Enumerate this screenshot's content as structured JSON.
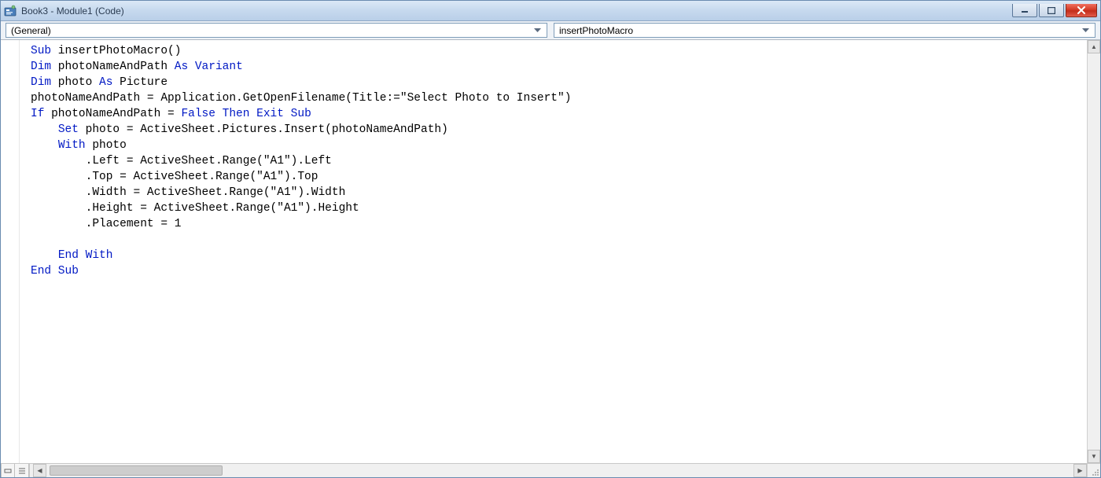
{
  "window": {
    "title": "Book3 - Module1 (Code)"
  },
  "dropdowns": {
    "object": "(General)",
    "procedure": "insertPhotoMacro"
  },
  "icons": {
    "app": "vba-module-icon",
    "minimize": "minimize-icon",
    "maximize": "maximize-icon",
    "close": "close-icon",
    "chevron": "chevron-down-icon",
    "scrollUp": "scroll-up-icon",
    "scrollDown": "scroll-down-icon",
    "procView": "procedure-view-icon",
    "fullView": "full-module-view-icon",
    "grip": "resize-grip-icon"
  },
  "code": {
    "tokens": [
      [
        {
          "t": "kw",
          "v": "Sub"
        },
        {
          "t": "",
          "v": " insertPhotoMacro()"
        }
      ],
      [
        {
          "t": "kw",
          "v": "Dim"
        },
        {
          "t": "",
          "v": " photoNameAndPath "
        },
        {
          "t": "kw",
          "v": "As Variant"
        }
      ],
      [
        {
          "t": "kw",
          "v": "Dim"
        },
        {
          "t": "",
          "v": " photo "
        },
        {
          "t": "kw",
          "v": "As"
        },
        {
          "t": "",
          "v": " Picture"
        }
      ],
      [
        {
          "t": "",
          "v": "photoNameAndPath = Application.GetOpenFilename(Title:=\"Select Photo to Insert\")"
        }
      ],
      [
        {
          "t": "kw",
          "v": "If"
        },
        {
          "t": "",
          "v": " photoNameAndPath = "
        },
        {
          "t": "kw",
          "v": "False Then Exit Sub"
        }
      ],
      [
        {
          "t": "",
          "v": "    "
        },
        {
          "t": "kw",
          "v": "Set"
        },
        {
          "t": "",
          "v": " photo = ActiveSheet.Pictures.Insert(photoNameAndPath)"
        }
      ],
      [
        {
          "t": "",
          "v": "    "
        },
        {
          "t": "kw",
          "v": "With"
        },
        {
          "t": "",
          "v": " photo"
        }
      ],
      [
        {
          "t": "",
          "v": "        .Left = ActiveSheet.Range(\"A1\").Left"
        }
      ],
      [
        {
          "t": "",
          "v": "        .Top = ActiveSheet.Range(\"A1\").Top"
        }
      ],
      [
        {
          "t": "",
          "v": "        .Width = ActiveSheet.Range(\"A1\").Width"
        }
      ],
      [
        {
          "t": "",
          "v": "        .Height = ActiveSheet.Range(\"A1\").Height"
        }
      ],
      [
        {
          "t": "",
          "v": "        .Placement = 1"
        }
      ],
      [
        {
          "t": "",
          "v": ""
        }
      ],
      [
        {
          "t": "",
          "v": "    "
        },
        {
          "t": "kw",
          "v": "End With"
        }
      ],
      [
        {
          "t": "kw",
          "v": "End Sub"
        }
      ]
    ]
  }
}
